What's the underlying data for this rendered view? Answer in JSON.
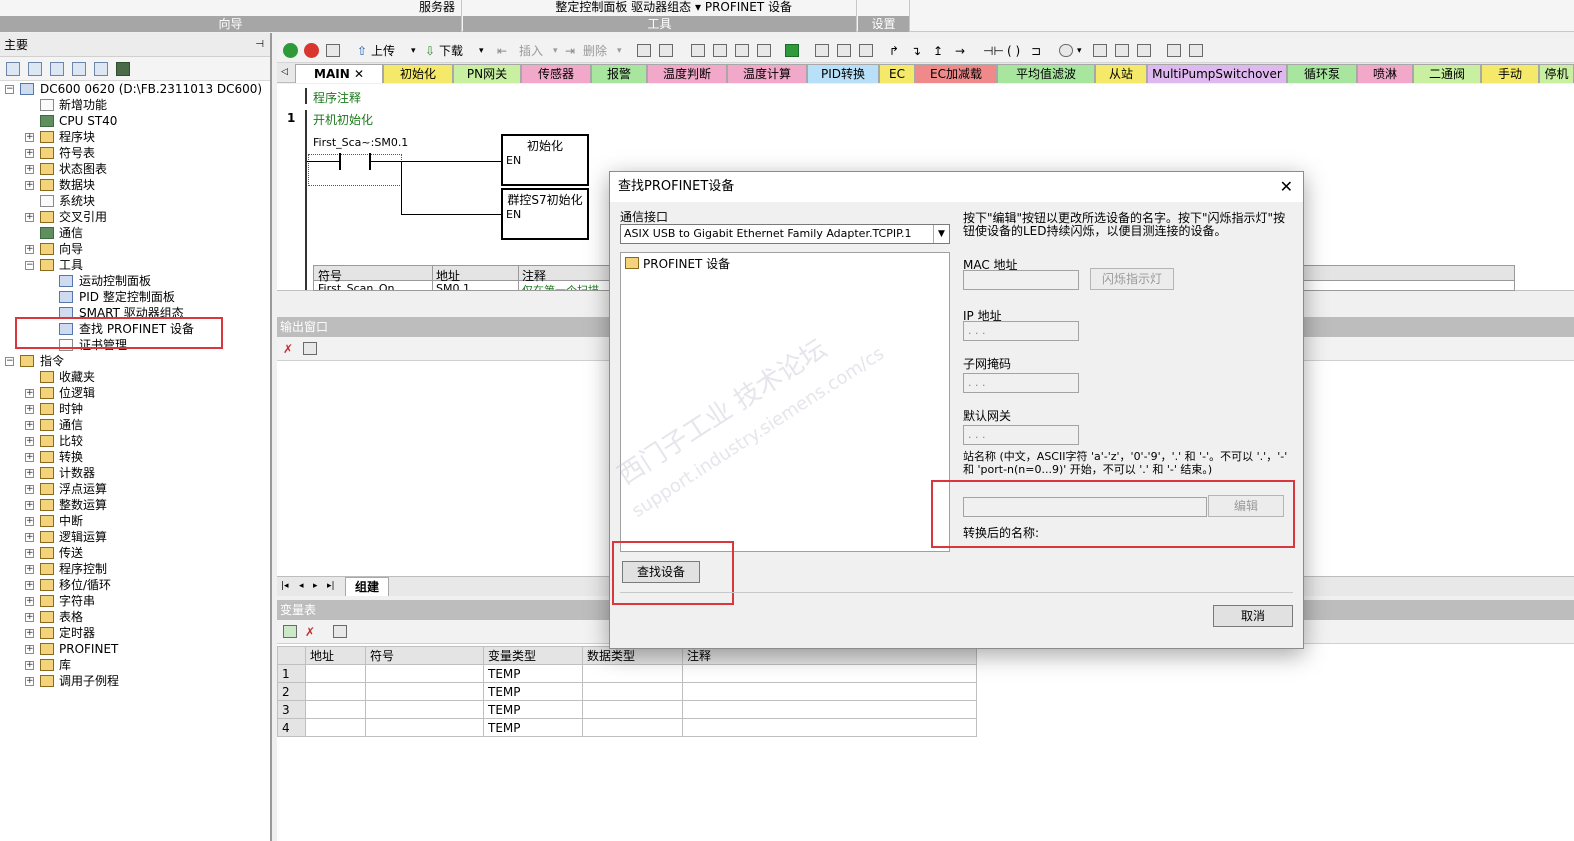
{
  "ribbon": {
    "groups": [
      {
        "items": "服务器",
        "label": "向导"
      },
      {
        "items": "整定控制面板 驱动器组态 ▾ PROFINET 设备",
        "label": "工具"
      },
      {
        "items": "",
        "label": "设置"
      }
    ]
  },
  "left_panel": {
    "title": "主要",
    "pin": "ᵖ",
    "tree": [
      {
        "label": "DC600 0620 (D:\\FB.2311013 DC600)"
      },
      {
        "label": "新增功能"
      },
      {
        "label": "CPU ST40"
      },
      {
        "label": "程序块"
      },
      {
        "label": "符号表"
      },
      {
        "label": "状态图表"
      },
      {
        "label": "数据块"
      },
      {
        "label": "系统块"
      },
      {
        "label": "交叉引用"
      },
      {
        "label": "通信"
      },
      {
        "label": "向导"
      },
      {
        "label": "工具"
      },
      {
        "label": "运动控制面板"
      },
      {
        "label": "PID 整定控制面板"
      },
      {
        "label": "SMART 驱动器组态"
      },
      {
        "label": "查找 PROFINET 设备"
      },
      {
        "label": "证书管理"
      },
      {
        "label": "指令"
      },
      {
        "label": "收藏夹"
      },
      {
        "label": "位逻辑"
      },
      {
        "label": "时钟"
      },
      {
        "label": "通信"
      },
      {
        "label": "比较"
      },
      {
        "label": "转换"
      },
      {
        "label": "计数器"
      },
      {
        "label": "浮点运算"
      },
      {
        "label": "整数运算"
      },
      {
        "label": "中断"
      },
      {
        "label": "逻辑运算"
      },
      {
        "label": "传送"
      },
      {
        "label": "程序控制"
      },
      {
        "label": "移位/循环"
      },
      {
        "label": "字符串"
      },
      {
        "label": "表格"
      },
      {
        "label": "定时器"
      },
      {
        "label": "PROFINET"
      },
      {
        "label": "库"
      },
      {
        "label": "调用子例程"
      }
    ]
  },
  "toolbar": {
    "upload": "上传",
    "download": "下载",
    "insert": "插入",
    "delete": "删除"
  },
  "tabs": [
    {
      "label": "MAIN",
      "color": "#ffffff"
    },
    {
      "label": "初始化",
      "color": "#f5e96a"
    },
    {
      "label": "PN网关",
      "color": "#c8f0a0"
    },
    {
      "label": "传感器",
      "color": "#f2a8c8"
    },
    {
      "label": "报警",
      "color": "#a8e6a0"
    },
    {
      "label": "温度判断",
      "color": "#f2a8c8"
    },
    {
      "label": "温度计算",
      "color": "#f2a8c8"
    },
    {
      "label": "PID转换",
      "color": "#b8e0f8"
    },
    {
      "label": "EC",
      "color": "#f5e96a"
    },
    {
      "label": "EC加减载",
      "color": "#f08a8a"
    },
    {
      "label": "平均值滤波",
      "color": "#a8e6a0"
    },
    {
      "label": "从站",
      "color": "#f5e96a"
    },
    {
      "label": "MultiPumpSwitchover",
      "color": "#e0b8f0"
    },
    {
      "label": "循环泵",
      "color": "#a8e6a0"
    },
    {
      "label": "喷淋",
      "color": "#f2a8c8"
    },
    {
      "label": "二通阀",
      "color": "#c8f0a0"
    },
    {
      "label": "手动",
      "color": "#f5e96a"
    },
    {
      "label": "停机",
      "color": "#c8f0a0"
    }
  ],
  "editor": {
    "program_comment": "程序注释",
    "network_number": "1",
    "network_title": "开机初始化",
    "contact_label": "First_Sca~:SM0.1",
    "box1_title": "初始化",
    "box1_en": "EN",
    "box2_title": "群控S7初始化",
    "box2_en": "EN",
    "sym_headers": [
      "符号",
      "地址",
      "注释"
    ],
    "sym_row": [
      "First_Scan_On",
      "SM0.1",
      "仅在第一个扫描"
    ]
  },
  "output_window": {
    "title": "输出窗口"
  },
  "bottom_tab": {
    "label": "组建"
  },
  "var_table": {
    "title": "变量表",
    "headers": [
      "",
      "地址",
      "符号",
      "变量类型",
      "数据类型",
      "注释"
    ],
    "rows": [
      {
        "n": "1",
        "type": "TEMP"
      },
      {
        "n": "2",
        "type": "TEMP"
      },
      {
        "n": "3",
        "type": "TEMP"
      },
      {
        "n": "4",
        "type": "TEMP"
      }
    ]
  },
  "dialog": {
    "title": "查找PROFINET设备",
    "close": "✕",
    "interface_label": "通信接口",
    "interface_value": "ASIX USB to Gigabit Ethernet Family Adapter.TCPIP.1",
    "device_tree_root": "PROFINET 设备",
    "instructions": "按下\"编辑\"按钮以更改所选设备的名字。按下\"闪烁指示灯\"按钮使设备的LED持续闪烁，以便目测连接的设备。",
    "mac_label": "MAC 地址",
    "blink_button": "闪烁指示灯",
    "ip_label": "IP 地址",
    "subnet_label": "子网掩码",
    "gateway_label": "默认网关",
    "ip_placeholder": " .   .   . ",
    "station_label": "站名称 (中文，ASCII字符 'a'-'z'，'0'-'9'，'.' 和 '-'。不可以 '.'，'-' 和 'port-n(n=0...9)' 开始，不可以 '.' 和 '-' 结束。)",
    "edit_button": "编辑",
    "converted_label": "转换后的名称:",
    "find_button": "查找设备",
    "cancel_button": "取消"
  },
  "watermark": {
    "line1": "西门子工业 技术论坛",
    "line2": "support.industry.siemens.com/cs"
  },
  "colors": {
    "highlight_box": "#d9363e",
    "green_text": "#1a7a1a"
  }
}
